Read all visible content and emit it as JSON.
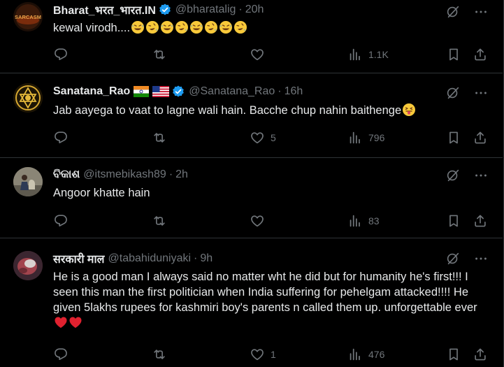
{
  "tweets": [
    {
      "name": "Bharat_भरत_भारत.IN",
      "handle": "@bharatalig",
      "time": "20h",
      "text": "kewal virodh....",
      "replies": "",
      "retweets": "",
      "likes": "",
      "views": "1.1K",
      "avatar_text": "SARCASM"
    },
    {
      "name": "Sanatana_Rao",
      "handle": "@Sanatana_Rao",
      "time": "16h",
      "text": "Jab aayega to vaat to lagne wali hain. Bacche chup nahin baithenge",
      "replies": "",
      "retweets": "",
      "likes": "5",
      "views": "796"
    },
    {
      "name": "ବିକାଶ",
      "handle": "@itsmebikash89",
      "time": "2h",
      "text": "Angoor khatte hain",
      "replies": "",
      "retweets": "",
      "likes": "",
      "views": "83"
    },
    {
      "name": "सरकारी माल",
      "handle": "@tabahiduniyaki",
      "time": "9h",
      "text": "He is a good man I always said no matter wht he did but for humanity he's first!!! I seen this man the first politician when India suffering for pehelgam attacked!!!! He given 5lakhs rupees for kashmiri boy's parents n called them up.  unforgettable ever",
      "replies": "",
      "retweets": "",
      "likes": "1",
      "views": "476"
    }
  ],
  "icons": {
    "reply": "reply-icon",
    "retweet": "retweet-icon",
    "like": "heart-icon",
    "views": "views-icon",
    "bookmark": "bookmark-icon",
    "share": "share-icon",
    "grok": "grok-icon",
    "more": "more-icon"
  },
  "colors": {
    "background": "#000000",
    "text": "#e7e9ea",
    "muted": "#71767b",
    "divider": "#2f3336",
    "verified": "#1d9bf0"
  }
}
